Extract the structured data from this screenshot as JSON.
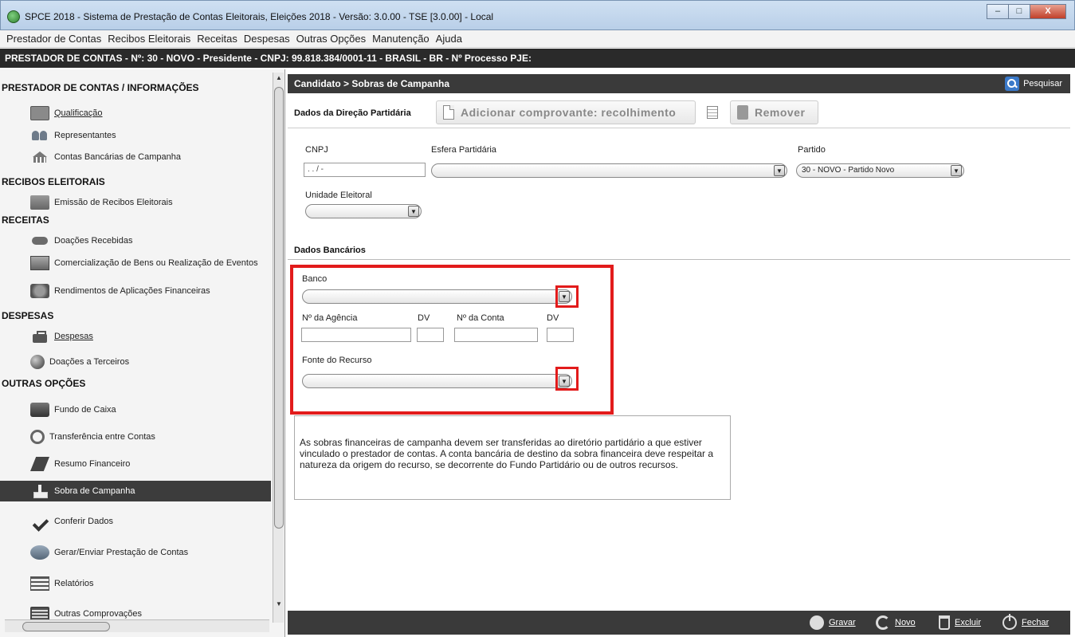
{
  "window": {
    "title": "SPCE 2018 - Sistema de Prestação de Contas Eleitorais, Eleições 2018 - Versão: 3.0.00  -  TSE [3.0.00] - Local",
    "min_label": "–",
    "max_label": "□",
    "close_label": "X"
  },
  "menu": [
    "Prestador de Contas",
    "Recibos Eleitorais",
    "Receitas",
    "Despesas",
    "Outras Opções",
    "Manutenção",
    "Ajuda"
  ],
  "infobar": "PRESTADOR DE CONTAS - Nº: 30 - NOVO - Presidente - CNPJ: 99.818.384/0001-11 - BRASIL - BR - Nº Processo PJE:",
  "sidebar": {
    "sections": {
      "prestador": "PRESTADOR DE CONTAS / INFORMAÇÕES",
      "recibos": "RECIBOS ELEITORAIS",
      "receitas": "RECEITAS",
      "despesas": "DESPESAS",
      "outras": "OUTRAS OPÇÕES"
    },
    "items": [
      {
        "label": "Qualificação",
        "icon": "id-card-icon"
      },
      {
        "label": "Representantes",
        "icon": "people-icon"
      },
      {
        "label": "Contas Bancárias de Campanha",
        "icon": "bank-icon"
      },
      {
        "label": "Emissão de Recibos Eleitorais",
        "icon": "receipt-icon"
      },
      {
        "label": "Doações Recebidas",
        "icon": "donation-hand-icon"
      },
      {
        "label": "Comercialização de Bens ou Realização de Eventos",
        "icon": "goods-box-icon"
      },
      {
        "label": "Rendimentos de Aplicações Financeiras",
        "icon": "coins-icon"
      },
      {
        "label": "Despesas",
        "icon": "bag-icon"
      },
      {
        "label": "Doações a Terceiros",
        "icon": "globe-icon"
      },
      {
        "label": "Fundo de Caixa",
        "icon": "cash-register-icon"
      },
      {
        "label": "Transferência entre Contas",
        "icon": "transfer-icon"
      },
      {
        "label": "Resumo Financeiro",
        "icon": "report-icon"
      },
      {
        "label": "Sobra de Campanha",
        "icon": "leftover-icon"
      },
      {
        "label": "Conferir Dados",
        "icon": "check-icon"
      },
      {
        "label": "Gerar/Enviar Prestação de Contas",
        "icon": "send-icon"
      },
      {
        "label": "Relatórios",
        "icon": "list-icon"
      },
      {
        "label": "Outras Comprovações",
        "icon": "documents-icon"
      }
    ]
  },
  "content": {
    "breadcrumb": "Candidato > Sobras de Campanha",
    "search_label": "Pesquisar",
    "section_label": "Dados da Direção Partidária",
    "add_button": "Adicionar comprovante: recolhimento",
    "remove_button": "Remover",
    "cnpj": {
      "label": "CNPJ",
      "value": " .  .  /  -"
    },
    "esfera": {
      "label": "Esfera Partidária",
      "value": ""
    },
    "partido": {
      "label": "Partido",
      "value": "30 - NOVO - Partido Novo"
    },
    "unidade": {
      "label": "Unidade Eleitoral",
      "value": ""
    },
    "bank_section": "Dados Bancários",
    "banco": {
      "label": "Banco",
      "value": ""
    },
    "agencia": {
      "label": "Nº da Agência",
      "value": ""
    },
    "dv1": {
      "label": "DV",
      "value": ""
    },
    "conta": {
      "label": "Nº da Conta",
      "value": ""
    },
    "dv2": {
      "label": "DV",
      "value": ""
    },
    "fonte": {
      "label": "Fonte do Recurso",
      "value": ""
    },
    "info_text": "As sobras financeiras de campanha devem ser transferidas ao diretório partidário a que estiver vinculado o prestador de contas. A conta bancária de destino da sobra financeira deve respeitar a natureza da origem do recurso, se decorrente do Fundo Partidário ou de outros recursos."
  },
  "footer": {
    "save": "Gravar",
    "new": "Novo",
    "delete": "Excluir",
    "close": "Fechar"
  },
  "colors": {
    "highlight_red": "#e21b1b",
    "header_dark": "#3a3a3a",
    "active_item": "#3c3c3c"
  }
}
